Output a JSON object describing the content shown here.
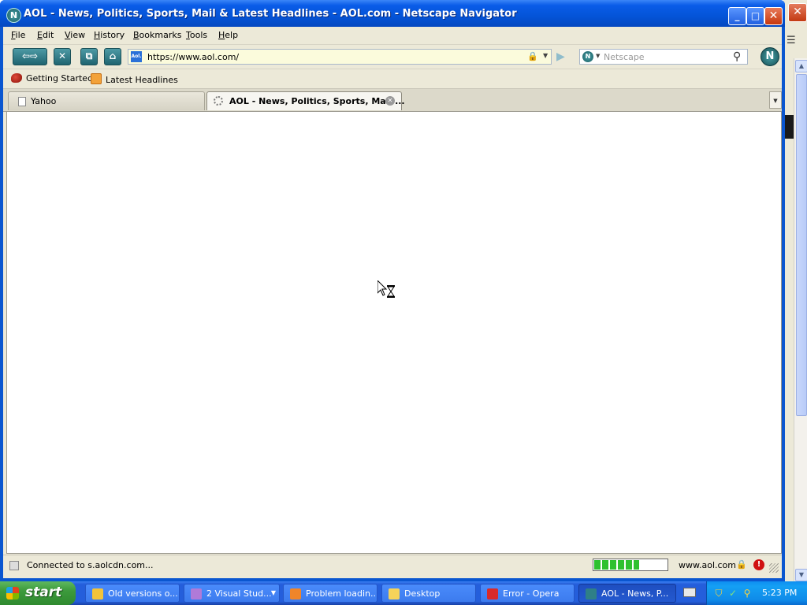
{
  "window": {
    "title": "AOL - News, Politics, Sports, Mail & Latest Headlines - AOL.com - Netscape Navigator",
    "controls": {
      "minimize": "_",
      "maximize": "□",
      "close": "✕"
    }
  },
  "menu": {
    "items": [
      {
        "label": "File",
        "key": "F",
        "rest": "ile"
      },
      {
        "label": "Edit",
        "key": "E",
        "rest": "dit"
      },
      {
        "label": "View",
        "key": "V",
        "rest": "iew"
      },
      {
        "label": "History",
        "key": "H",
        "rest": "istory"
      },
      {
        "label": "Bookmarks",
        "key": "B",
        "rest": "ookmarks"
      },
      {
        "label": "Tools",
        "key": "T",
        "rest": "ools"
      },
      {
        "label": "Help",
        "key": "H",
        "rest": "elp"
      }
    ]
  },
  "toolbar": {
    "url": "https://www.aol.com/",
    "favicon_text": "Aol.",
    "search_placeholder": "Netscape"
  },
  "bookmarks": [
    {
      "label": "Getting Started"
    },
    {
      "label": "Latest Headlines"
    }
  ],
  "tabs": [
    {
      "label": "Yahoo",
      "active": false
    },
    {
      "label": "AOL - News, Politics, Sports, Mail ...",
      "active": true
    }
  ],
  "status": {
    "text": "Connected to s.aolcdn.com...",
    "host": "www.aol.com",
    "progress_fraction": 0.62
  },
  "taskbar": {
    "start_label": "start",
    "tasks": [
      {
        "label": "Old versions o...",
        "icon_color": "#f2c33a",
        "active": false,
        "dropdown": false
      },
      {
        "label": "2 Visual Stud...",
        "icon_color": "#b07ad8",
        "active": false,
        "dropdown": true
      },
      {
        "label": "Problem loadin...",
        "icon_color": "#f0852a",
        "active": false,
        "dropdown": false
      },
      {
        "label": "Desktop",
        "icon_color": "#f6d35a",
        "active": false,
        "dropdown": false
      },
      {
        "label": "Error - Opera",
        "icon_color": "#d92a2a",
        "active": false,
        "dropdown": false
      },
      {
        "label": "AOL - News, P...",
        "icon_color": "#2f7f87",
        "active": true,
        "dropdown": false
      }
    ],
    "clock": "5:23 PM"
  },
  "colors": {
    "titlebar": "#0454d8",
    "chrome": "#ece9d8",
    "url_bg": "#fbfbdc",
    "taskbar": "#245edb",
    "start": "#3c9a3c"
  }
}
